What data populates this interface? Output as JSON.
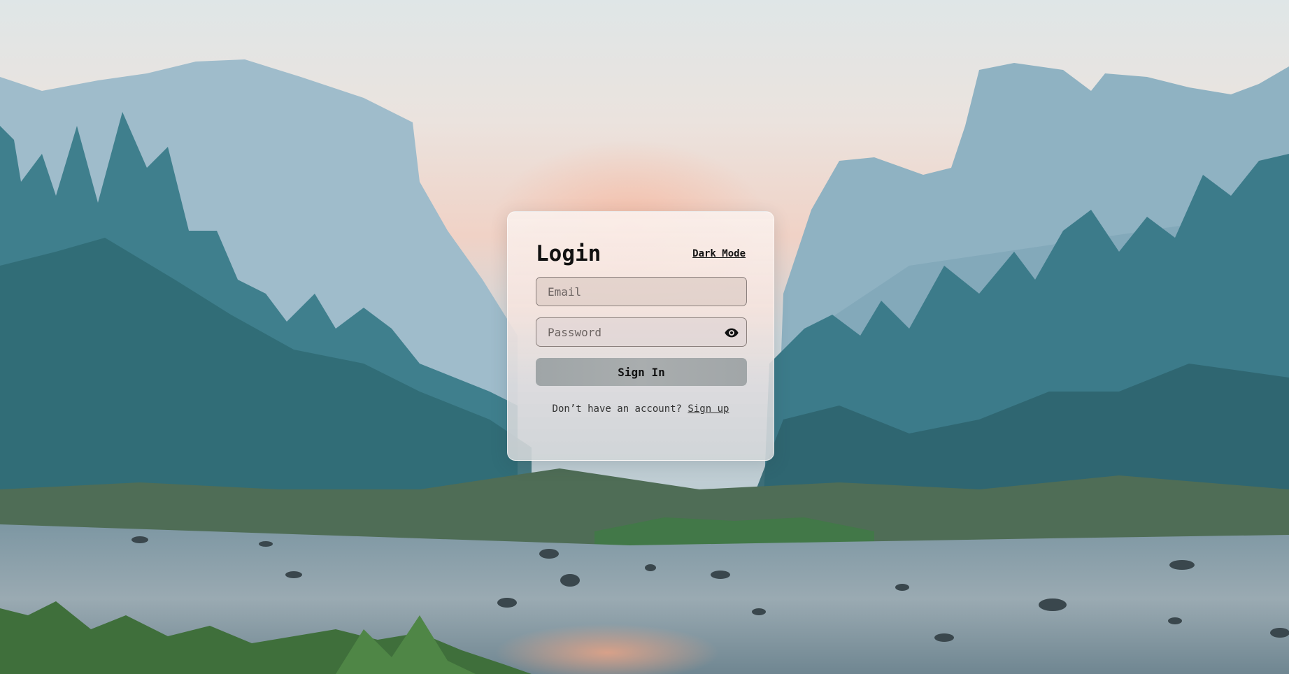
{
  "login": {
    "title": "Login",
    "dark_mode_label": "Dark Mode",
    "email_placeholder": "Email",
    "password_placeholder": "Password",
    "sign_in_label": "Sign In",
    "signup_prompt": "Don’t have an account?",
    "signup_link": "Sign up"
  },
  "icons": {
    "password_toggle": "eye-icon"
  },
  "colors": {
    "text": "#111111",
    "button_bg": "#a5aaac",
    "input_border": "#8a7f7c"
  }
}
